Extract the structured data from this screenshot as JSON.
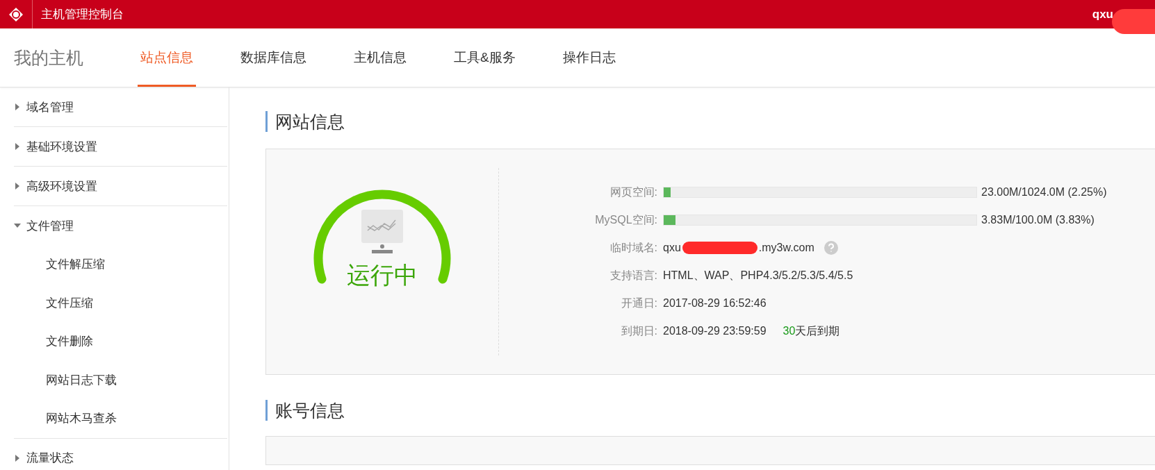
{
  "topbar": {
    "title": "主机管理控制台",
    "user": "qxu"
  },
  "nav": {
    "brand": "我的主机",
    "tabs": [
      {
        "label": "站点信息",
        "selected": true
      },
      {
        "label": "数据库信息",
        "selected": false
      },
      {
        "label": "主机信息",
        "selected": false
      },
      {
        "label": "工具&服务",
        "selected": false
      },
      {
        "label": "操作日志",
        "selected": false
      }
    ]
  },
  "sidebar": {
    "items": [
      {
        "label": "域名管理",
        "expanded": false
      },
      {
        "label": "基础环境设置",
        "expanded": false
      },
      {
        "label": "高级环境设置",
        "expanded": false
      },
      {
        "label": "文件管理",
        "expanded": true,
        "children": [
          {
            "label": "文件解压缩"
          },
          {
            "label": "文件压缩"
          },
          {
            "label": "文件删除"
          },
          {
            "label": "网站日志下载"
          },
          {
            "label": "网站木马查杀"
          }
        ]
      },
      {
        "label": "流量状态",
        "expanded": false
      }
    ]
  },
  "site_info": {
    "heading": "网站信息",
    "status": "运行中",
    "rows": [
      {
        "kind": "meter",
        "label": "网页空间:",
        "level": 0.0225,
        "reading": "23.00M/1024.0M (2.25%)"
      },
      {
        "kind": "meter",
        "label": "MySQL空间:",
        "level": 0.0383,
        "reading": "3.83M/100.0M (3.83%)"
      },
      {
        "kind": "domain",
        "label": "临时域名:",
        "value": "qxu",
        "value_end": ".my3w.com"
      },
      {
        "kind": "text",
        "label": "支持语言:",
        "value": "HTML、WAP、PHP4.3/5.2/5.3/5.4/5.5"
      },
      {
        "kind": "text",
        "label": "开通日:",
        "value": "2017-08-29 16:52:46"
      },
      {
        "kind": "expiry",
        "label": "到期日:",
        "value": "2018-09-29 23:59:59",
        "days": "30",
        "days_text": "天后到期"
      }
    ]
  },
  "account_info": {
    "heading": "账号信息"
  }
}
